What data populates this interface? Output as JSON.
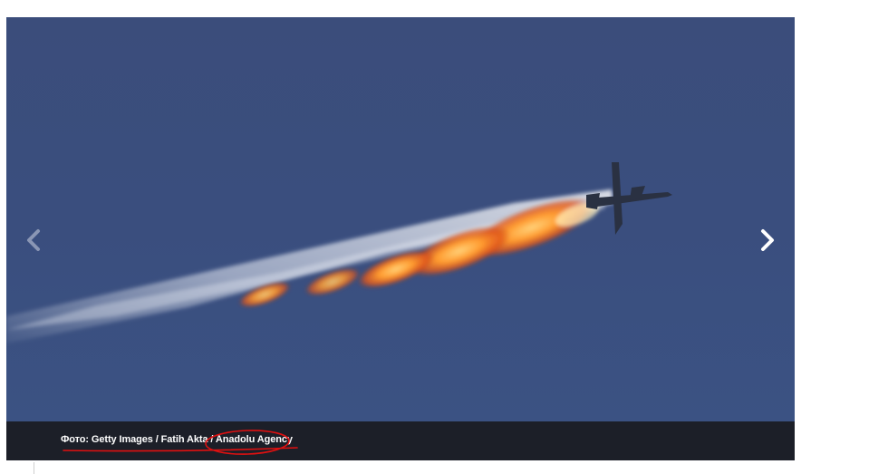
{
  "gallery": {
    "caption": "Фото: Getty Images / Fatih Akta / Anadolu Agency",
    "prev_icon": "chevron-left-icon",
    "next_icon": "chevron-right-icon",
    "photo_icon": "burning-jet-photo"
  },
  "colors": {
    "sky": "#3a4d7c",
    "caption_bar": "#1c1f28",
    "caption_text": "#ffffff",
    "annotation": "#e01010"
  }
}
